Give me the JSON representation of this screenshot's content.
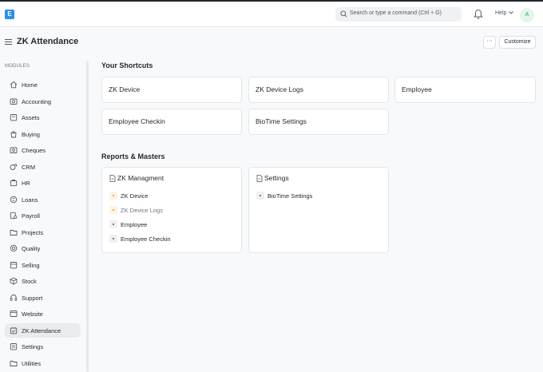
{
  "app": {
    "logo_letter": "E"
  },
  "navbar": {
    "search_placeholder": "Search or type a command (Ctrl + G)",
    "help_label": "Help",
    "avatar_initial": "A"
  },
  "page": {
    "title": "ZK Attendance",
    "more_label": "···",
    "customize_label": "Customize"
  },
  "sidebar": {
    "section_label": "MODULES",
    "items": [
      {
        "label": "Home",
        "icon": "home-icon"
      },
      {
        "label": "Accounting",
        "icon": "accounting-icon"
      },
      {
        "label": "Assets",
        "icon": "assets-icon"
      },
      {
        "label": "Buying",
        "icon": "buying-icon"
      },
      {
        "label": "Cheques",
        "icon": "cheques-icon"
      },
      {
        "label": "CRM",
        "icon": "crm-icon"
      },
      {
        "label": "HR",
        "icon": "hr-icon"
      },
      {
        "label": "Loans",
        "icon": "loans-icon"
      },
      {
        "label": "Payroll",
        "icon": "payroll-icon"
      },
      {
        "label": "Projects",
        "icon": "projects-icon"
      },
      {
        "label": "Quality",
        "icon": "quality-icon"
      },
      {
        "label": "Selling",
        "icon": "selling-icon"
      },
      {
        "label": "Stock",
        "icon": "stock-icon"
      },
      {
        "label": "Support",
        "icon": "support-icon"
      },
      {
        "label": "Website",
        "icon": "website-icon"
      },
      {
        "label": "ZK Attendance",
        "icon": "attendance-icon",
        "active": true
      },
      {
        "label": "Settings",
        "icon": "settings-icon"
      },
      {
        "label": "Utilities",
        "icon": "utilities-icon"
      }
    ]
  },
  "shortcuts": {
    "title": "Your Shortcuts",
    "items": [
      {
        "label": "ZK Device"
      },
      {
        "label": "ZK Device Logs"
      },
      {
        "label": "Employee"
      },
      {
        "label": "Employee Checkin"
      },
      {
        "label": "BioTime Settings"
      }
    ]
  },
  "reports": {
    "title": "Reports & Masters",
    "cards": [
      {
        "title": "ZK Managment",
        "links": [
          {
            "label": "ZK Device",
            "style": "warn"
          },
          {
            "label": "ZK Device Logs",
            "style": "warn-muted"
          },
          {
            "label": "Employee",
            "style": "normal"
          },
          {
            "label": "Employee Checkin",
            "style": "normal"
          }
        ]
      },
      {
        "title": "Settings",
        "links": [
          {
            "label": "BioTime Settings",
            "style": "normal"
          }
        ]
      }
    ]
  },
  "colors": {
    "accent": "#2490ef",
    "warning_dot": "#e8913a",
    "active_item_bg": "#e9ebed"
  }
}
